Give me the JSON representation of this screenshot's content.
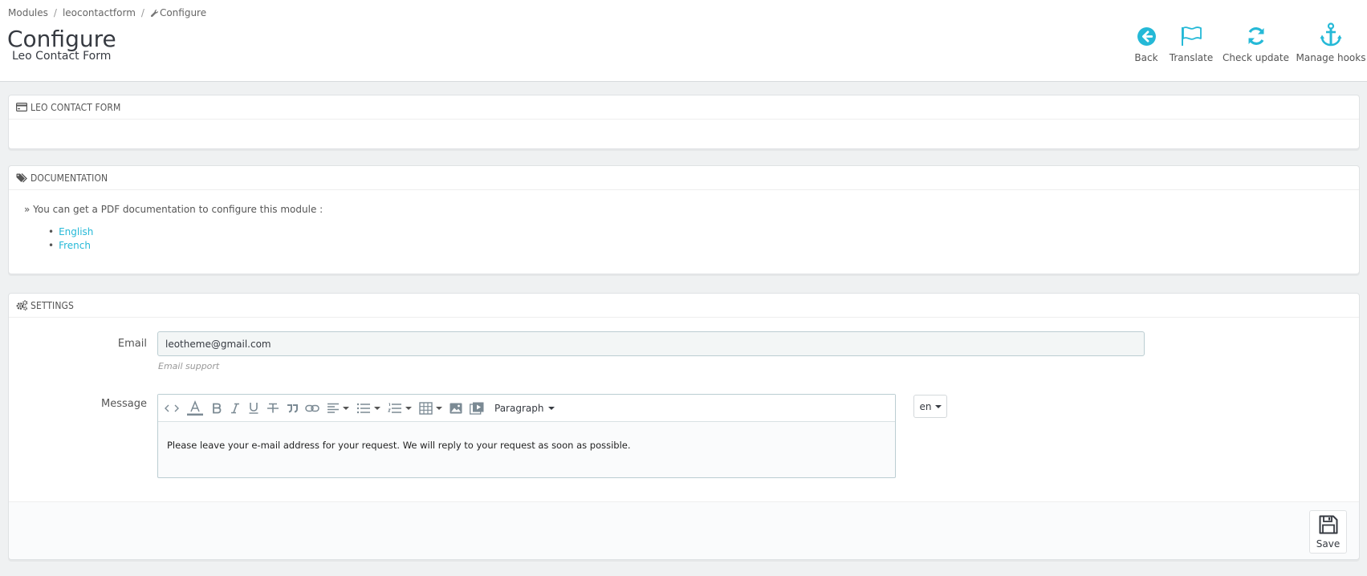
{
  "breadcrumb": {
    "items": [
      "Modules",
      "leocontactform",
      "Configure"
    ],
    "separator": "/"
  },
  "header": {
    "title": "Configure",
    "subtitle": "Leo Contact Form"
  },
  "toolbar": {
    "back_label": "Back",
    "translate_label": "Translate",
    "check_update_label": "Check update",
    "manage_hooks_label": "Manage hooks",
    "icon_color": "#25b9d7"
  },
  "panels": {
    "leo": {
      "title": "LEO CONTACT FORM"
    },
    "documentation": {
      "title": "DOCUMENTATION",
      "text": "» You can get a PDF documentation to configure this module :",
      "links": [
        "English",
        "French"
      ]
    },
    "settings": {
      "title": "SETTINGS",
      "email_label": "Email",
      "email_value": "leotheme@gmail.com",
      "email_help": "Email support",
      "message_label": "Message",
      "editor_format": "Paragraph",
      "editor_content": "Please leave your e-mail address for your request. We will reply to your request as soon as possible.",
      "language": "en",
      "save_label": "Save"
    }
  },
  "colors": {
    "accent": "#25b9d7",
    "text": "#555555",
    "background": "#eff1f2"
  }
}
